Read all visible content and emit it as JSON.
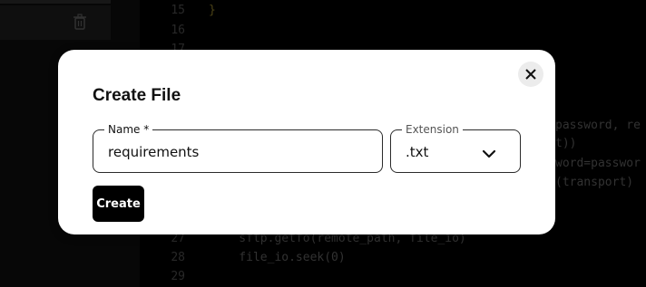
{
  "sidebar": {
    "trash_icon": "trash-icon"
  },
  "editor": {
    "lines": [
      {
        "num": "15",
        "code": "}"
      },
      {
        "num": "16",
        "code": ""
      },
      {
        "num": "17",
        "code": ""
      },
      {
        "num": "27",
        "code": "    sftp.getfo(remote_path, file_io)"
      },
      {
        "num": "28",
        "code": "    file_io.seek(0)"
      },
      {
        "num": "29",
        "code": ""
      }
    ],
    "right_fragments": [
      "password, re",
      "t))",
      "word=passwor",
      "(transport)"
    ]
  },
  "modal": {
    "title": "Create File",
    "close_icon": "close-icon",
    "name_field": {
      "label": "Name *",
      "value": "requirements"
    },
    "extension_field": {
      "label": "Extension",
      "value": ".txt",
      "icon": "chevron-down-icon"
    },
    "create_button": "Create"
  }
}
